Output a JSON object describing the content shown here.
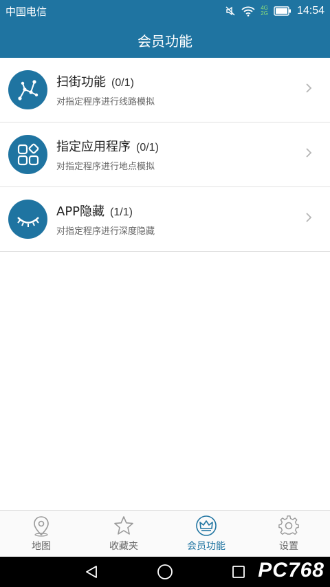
{
  "status": {
    "carrier": "中国电信",
    "network_top": "4G",
    "network_bottom": "2G",
    "time": "14:54"
  },
  "header": {
    "title": "会员功能"
  },
  "features": [
    {
      "name": "扫街功能",
      "count": "(0/1)",
      "desc": "对指定程序进行线路模拟",
      "icon": "route-icon"
    },
    {
      "name": "指定应用程序",
      "count": "(0/1)",
      "desc": "对指定程序进行地点模拟",
      "icon": "apps-grid-icon"
    },
    {
      "name": "APP隐藏",
      "count": "(1/1)",
      "desc": "对指定程序进行深度隐藏",
      "icon": "closed-eye-icon"
    }
  ],
  "tabs": [
    {
      "label": "地图",
      "icon": "map-pin-icon",
      "active": false
    },
    {
      "label": "收藏夹",
      "icon": "star-icon",
      "active": false
    },
    {
      "label": "会员功能",
      "icon": "crown-icon",
      "active": true
    },
    {
      "label": "设置",
      "icon": "gear-icon",
      "active": false
    }
  ],
  "watermark": "PC768",
  "colors": {
    "primary": "#1f74a1",
    "text": "#222222",
    "subtext": "#666666",
    "divider": "#e1e1e1"
  }
}
